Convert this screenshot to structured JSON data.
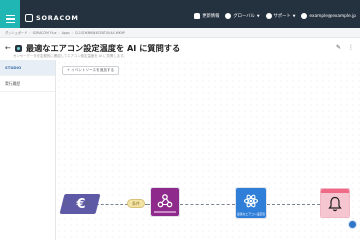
{
  "brand": {
    "logo_text": "SORACOM"
  },
  "topbar": {
    "items": [
      {
        "icon": "bell-icon",
        "label": "更新情報"
      },
      {
        "icon": "globe-icon",
        "label": "グローバル"
      },
      {
        "icon": "support-icon",
        "label": "サポート"
      },
      {
        "icon": "user-icon",
        "label": "example@example.jp"
      }
    ]
  },
  "breadcrumb": {
    "items": [
      "ダッシュボード",
      "SORACOM Flux",
      "Apps",
      "CL1SOKMKW4E2NTXU4A WK9P"
    ]
  },
  "header": {
    "title": "最適なエアコン設定温度を AI に質問する",
    "description": "センサーデータを定期的に確認してエアコン設定温度を AI に質問します。"
  },
  "sidebar": {
    "items": [
      {
        "label": "STUDIO",
        "active": true
      },
      {
        "label": "実行履歴",
        "active": false
      }
    ]
  },
  "canvas": {
    "add_source_label": "+ イベントソースを追加する",
    "nodes": [
      {
        "name": "event-source",
        "icon": "euro-like-icon",
        "color": "#5e5aa6"
      },
      {
        "name": "condition",
        "label": "条件",
        "color": "#f4e4a3"
      },
      {
        "name": "webhook-1",
        "icon": "webhook-icon",
        "color": "#8e2a8c"
      },
      {
        "name": "ai-action",
        "icon": "atom-icon",
        "color": "#2f7fd8",
        "label": "最適なエアコン設定温度を AI..."
      },
      {
        "name": "notification",
        "icon": "bell-icon",
        "color": "#f6c6d0"
      }
    ],
    "zoom_controls": [
      "+",
      "−",
      "⟳"
    ]
  },
  "colors": {
    "topbar": "#24313f",
    "accent": "#1fb6b3",
    "source": "#5e5aa6",
    "webhook": "#8e2a8c",
    "ai": "#2f7fd8",
    "notify": "#f6c6d0"
  }
}
